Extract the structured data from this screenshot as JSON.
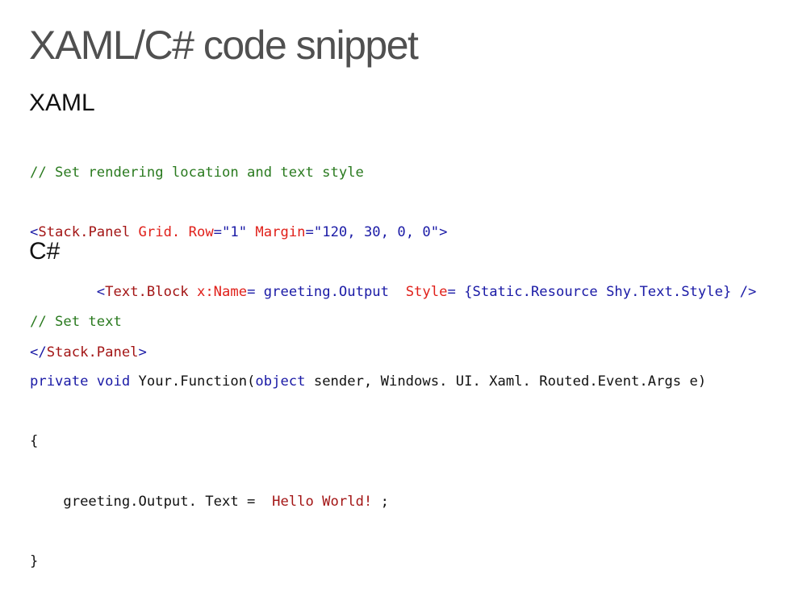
{
  "title": "XAML/C# code snippet",
  "xaml": {
    "heading": "XAML",
    "comment": "// Set rendering location and text style",
    "line2": {
      "open": "<",
      "tag": "Stack.Panel",
      "attr1": " Grid. Row",
      "eq1": "=",
      "val1": "\"1\"",
      "attr2": " Margin",
      "eq2": "=",
      "val2": "\"120, 30, 0, 0\"",
      "close": ">"
    },
    "line3": {
      "indent": "        ",
      "open": "<",
      "tag": "Text.Block",
      "attr1": " x:Name",
      "eq1": "=",
      "val1": " greeting.Output  ",
      "attr2": "Style",
      "eq2": "=",
      "val2": " {Static.Resource Shy.Text.Style}",
      "close": " />"
    },
    "line4": {
      "open": "</",
      "tag": "Stack.Panel",
      "close": ">"
    }
  },
  "csharp": {
    "heading": "C#",
    "comment": "// Set text",
    "line2": {
      "kw1": "private",
      "kw2": " void",
      "fn": " Your.Function(",
      "kw3": "object",
      "rest": " sender, Windows. UI. Xaml. Routed.Event.Args e)"
    },
    "line3": "{",
    "line4": {
      "lhs": "    greeting.Output. Text =  ",
      "str": "Hello World!",
      "end": " ;"
    },
    "line5": "}"
  }
}
